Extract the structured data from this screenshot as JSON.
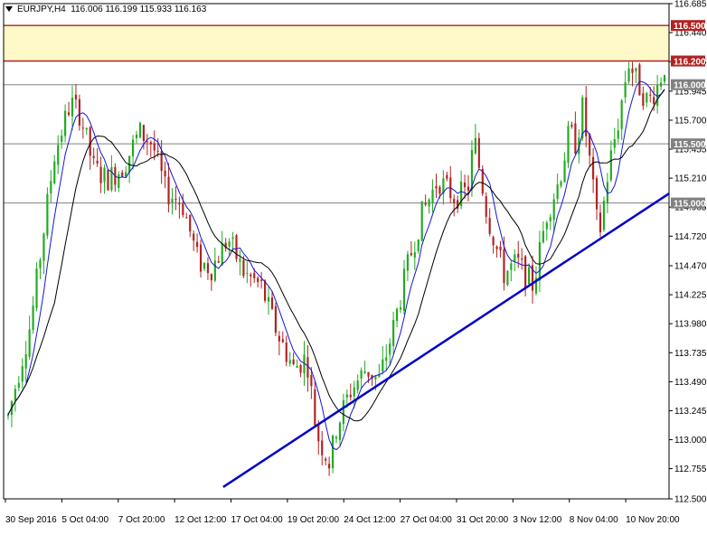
{
  "header": {
    "symbol": "EURJPY,H4",
    "ohlc": "116.006 116.199 115.933 116.163"
  },
  "colors": {
    "background": "#ffffff",
    "bull": "#22aa22",
    "bear": "#b22222",
    "ma_fast": "#1515d6",
    "ma_slow": "#000000",
    "trendline": "#0000cc",
    "resistance_zone": "#fff8c8",
    "resistance_line": "#b22222",
    "support_line": "#808080",
    "price_label_dark": "#141414"
  },
  "chart_data": {
    "type": "candlestick",
    "title": "EURJPY,H4",
    "ylim": [
      112.5,
      116.685
    ],
    "y_ticks": [
      "116.685",
      "116.440",
      "116.195",
      "115.945",
      "115.700",
      "115.455",
      "115.210",
      "114.965",
      "114.720",
      "114.470",
      "114.225",
      "113.980",
      "113.735",
      "113.490",
      "113.245",
      "113.000",
      "112.755",
      "112.500"
    ],
    "x_ticks": [
      "30 Sep 2016",
      "5 Oct 04:00",
      "7 Oct 20:00",
      "12 Oct 12:00",
      "17 Oct 04:00",
      "19 Oct 20:00",
      "24 Oct 12:00",
      "27 Oct 04:00",
      "31 Oct 20:00",
      "3 Nov 12:00",
      "8 Nov 04:00",
      "10 Nov 20:00"
    ],
    "levels": [
      {
        "label": "116.500",
        "value": 116.5,
        "kind": "resistance"
      },
      {
        "label": "116.200",
        "value": 116.2,
        "kind": "resistance"
      },
      {
        "label": "116.000",
        "value": 116.0,
        "kind": "support"
      },
      {
        "label": "115.500",
        "value": 115.5,
        "kind": "support"
      },
      {
        "label": "115.000",
        "value": 115.0,
        "kind": "support"
      }
    ],
    "current_price_label": "116.163",
    "resistance_zone": [
      116.2,
      116.5
    ],
    "trendline": {
      "from": {
        "bar": 0.33,
        "price": 112.6
      },
      "to": {
        "bar": 1.0,
        "price": 115.08
      }
    },
    "ma_fast_name": "",
    "ma_slow_name": "",
    "anchors": [
      [
        0,
        113.2
      ],
      [
        0.035,
        114.0
      ],
      [
        0.07,
        115.4
      ],
      [
        0.095,
        115.85
      ],
      [
        0.11,
        115.75
      ],
      [
        0.13,
        115.3
      ],
      [
        0.15,
        115.2
      ],
      [
        0.175,
        115.3
      ],
      [
        0.2,
        115.6
      ],
      [
        0.22,
        115.5
      ],
      [
        0.24,
        115.1
      ],
      [
        0.265,
        115.0
      ],
      [
        0.29,
        114.5
      ],
      [
        0.31,
        114.45
      ],
      [
        0.335,
        114.7
      ],
      [
        0.36,
        114.4
      ],
      [
        0.385,
        114.3
      ],
      [
        0.41,
        113.9
      ],
      [
        0.435,
        113.6
      ],
      [
        0.455,
        113.7
      ],
      [
        0.47,
        113.05
      ],
      [
        0.49,
        112.8
      ],
      [
        0.5,
        113.1
      ],
      [
        0.52,
        113.4
      ],
      [
        0.545,
        113.6
      ],
      [
        0.565,
        113.5
      ],
      [
        0.585,
        113.9
      ],
      [
        0.61,
        114.5
      ],
      [
        0.63,
        114.9
      ],
      [
        0.655,
        115.2
      ],
      [
        0.68,
        115.05
      ],
      [
        0.7,
        115.1
      ],
      [
        0.71,
        115.55
      ],
      [
        0.73,
        114.9
      ],
      [
        0.755,
        114.4
      ],
      [
        0.775,
        114.5
      ],
      [
        0.8,
        114.3
      ],
      [
        0.82,
        114.9
      ],
      [
        0.84,
        115.2
      ],
      [
        0.855,
        115.6
      ],
      [
        0.865,
        115.5
      ],
      [
        0.875,
        115.8
      ],
      [
        0.885,
        115.4
      ],
      [
        0.9,
        114.7
      ],
      [
        0.915,
        115.3
      ],
      [
        0.93,
        115.7
      ],
      [
        0.945,
        116.2
      ],
      [
        0.96,
        116.0
      ],
      [
        0.975,
        115.85
      ],
      [
        0.99,
        116.0
      ],
      [
        1.0,
        116.16
      ]
    ]
  }
}
